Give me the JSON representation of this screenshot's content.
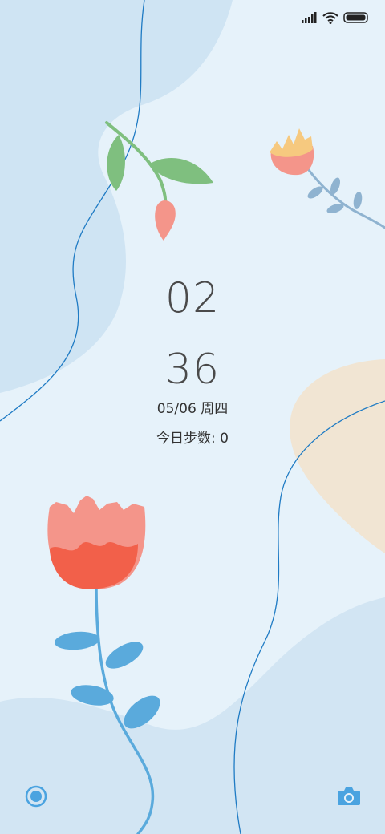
{
  "lock_screen": {
    "hours": "02",
    "minutes": "36",
    "date": "05/06 周四",
    "steps": "今日步数: 0"
  },
  "status_bar": {
    "icons": [
      "signal-icon",
      "wifi-icon",
      "battery-icon"
    ]
  },
  "shortcuts": {
    "left_icon": "assistant-icon",
    "right_icon": "camera-icon"
  },
  "colors": {
    "background": "#e6f2fa",
    "blob_blue": "#cfe4f3",
    "blob_beige": "#f1e5d3",
    "line_blue": "#1f7bc4",
    "flower_red": "#f2604a",
    "flower_pink": "#f4958a",
    "leaf_green": "#7fbf7f",
    "leaf_blue": "#5aaadc",
    "accent_blue": "#4aa3e0"
  }
}
